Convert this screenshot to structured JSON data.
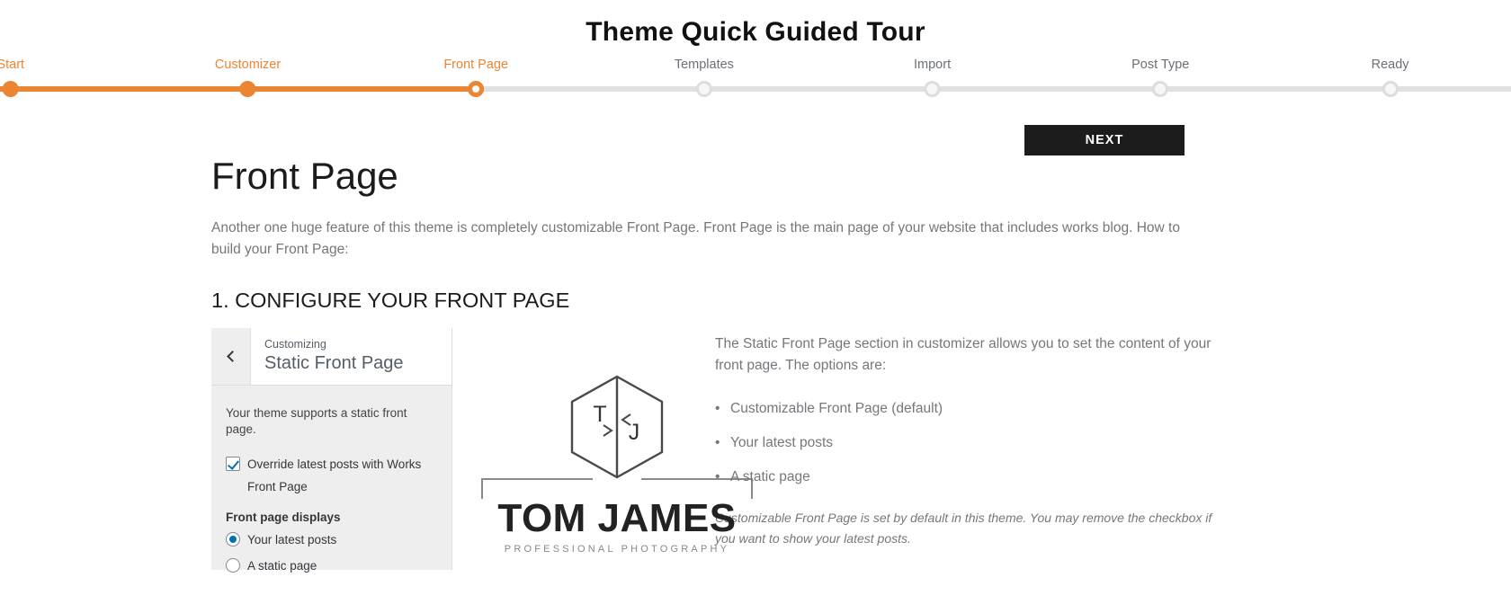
{
  "header": {
    "title": "Theme Quick Guided Tour"
  },
  "accent_color": "#ea8534",
  "stepper": {
    "steps": [
      {
        "label": "Start",
        "state": "done",
        "x_pct": 0.7
      },
      {
        "label": "Customizer",
        "state": "done",
        "x_pct": 16.4
      },
      {
        "label": "Front Page",
        "state": "current",
        "x_pct": 31.5
      },
      {
        "label": "Templates",
        "state": "pending",
        "x_pct": 46.6
      },
      {
        "label": "Import",
        "state": "pending",
        "x_pct": 61.7
      },
      {
        "label": "Post Type",
        "state": "pending",
        "x_pct": 76.8
      },
      {
        "label": "Ready",
        "state": "pending",
        "x_pct": 92.0
      }
    ],
    "progress_pct": 31.5
  },
  "toolbar": {
    "next_label": "NEXT"
  },
  "main": {
    "heading": "Front Page",
    "intro": "Another one huge feature of this theme is completely customizable Front Page. Front Page is the main page of your website that includes works blog. How to build your Front Page:",
    "section_heading": "1. CONFIGURE YOUR FRONT PAGE"
  },
  "customizer": {
    "back_icon": "chevron-left-icon",
    "customizing_label": "Customizing",
    "section_title": "Static Front Page",
    "support_text": "Your theme supports a static front page.",
    "override_checkbox": {
      "label": "Override latest posts with Works Front Page",
      "checked": true
    },
    "front_page_displays_label": "Front page displays",
    "radios": [
      {
        "label": "Your latest posts",
        "checked": true
      },
      {
        "label": "A static page",
        "checked": false
      }
    ]
  },
  "logo": {
    "monogram_top": "T",
    "monogram_bottom": "J",
    "name": "TOM JAMES",
    "subtitle": "PROFESSIONAL PHOTOGRAPHY"
  },
  "right_column": {
    "paragraph": "The Static Front Page section in customizer allows you to set the content of your front page. The options are:",
    "options": [
      "Customizable Front Page (default)",
      "Your latest posts",
      "A static page"
    ],
    "note": "Customizable Front Page is set by default in this theme. You may remove the checkbox if you want to show your latest posts."
  }
}
